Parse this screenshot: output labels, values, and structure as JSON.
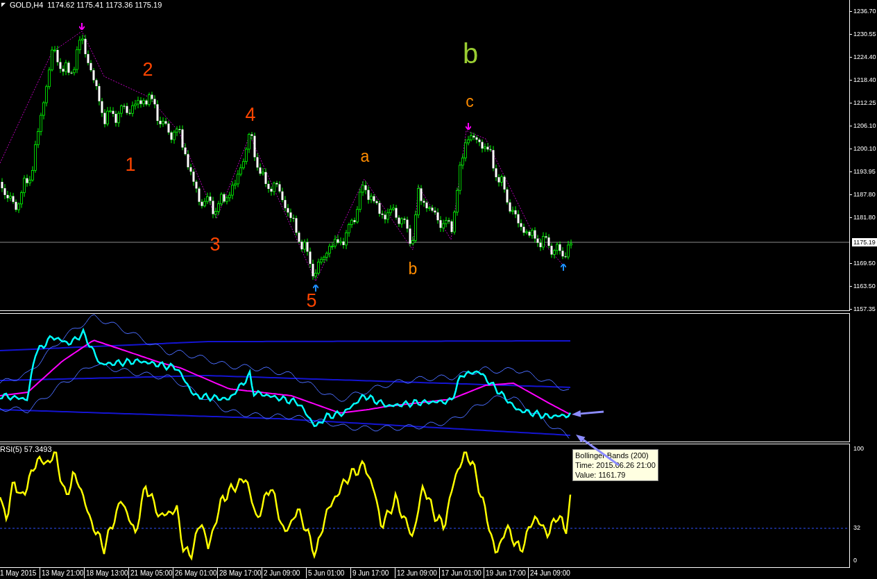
{
  "header": {
    "symbol": "GOLD,H4",
    "ohlc": "1174.62 1175.41 1173.36 1175.19"
  },
  "price_axis": {
    "ticks": [
      "1236.70",
      "1230.55",
      "1224.40",
      "1218.40",
      "1212.25",
      "1206.10",
      "1200.10",
      "1193.95",
      "1187.80",
      "1181.80",
      "1169.50",
      "1163.50",
      "1157.35"
    ],
    "current": "1175.19"
  },
  "wave_labels": [
    {
      "text": "2",
      "color": "#ff4500",
      "kind": "normal"
    },
    {
      "text": "1",
      "color": "#ff4500",
      "kind": "normal"
    },
    {
      "text": "4",
      "color": "#ff4500",
      "kind": "normal"
    },
    {
      "text": "3",
      "color": "#ff4500",
      "kind": "normal"
    },
    {
      "text": "5",
      "color": "#ff4500",
      "kind": "normal"
    },
    {
      "text": "a",
      "color": "#ff8c00",
      "kind": "small"
    },
    {
      "text": "b",
      "color": "#ff8c00",
      "kind": "small"
    },
    {
      "text": "c",
      "color": "#ff8c00",
      "kind": "small"
    },
    {
      "text": "b",
      "color": "#9acd32",
      "kind": "large"
    }
  ],
  "markers": [
    {
      "kind": "down",
      "color": "#ff00ff"
    },
    {
      "kind": "down",
      "color": "#ff00ff"
    },
    {
      "kind": "up",
      "color": "#1e90ff"
    },
    {
      "kind": "up",
      "color": "#1e90ff"
    }
  ],
  "tooltip": {
    "lines": [
      "Bollinger Bands (200)",
      "Time: 2015.06.26 21:00",
      "Value: 1161.79"
    ]
  },
  "rsi": {
    "label": "RSI(5) 57.3493",
    "axis": [
      "100",
      "32",
      "0"
    ]
  },
  "time_axis": [
    "1 May 2015",
    "13 May 21:00",
    "18 May 13:00",
    "21 May 05:00",
    "26 May 01:00",
    "28 May 17:00",
    "2 Jun 09:00",
    "5 Jun 01:00",
    "9 Jun 17:00",
    "12 Jun 09:00",
    "17 Jun 01:00",
    "19 Jun 17:00",
    "24 Jun 09:00"
  ]
}
